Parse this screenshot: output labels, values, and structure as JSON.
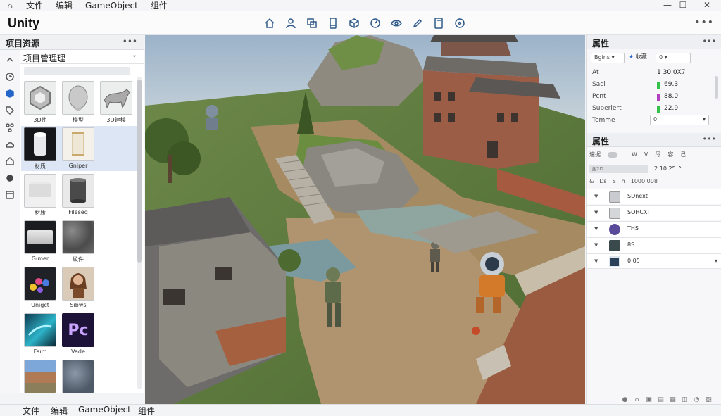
{
  "menubar": {
    "items": [
      "文件",
      "编辑",
      "GameObject",
      "组件"
    ]
  },
  "toolbar": {
    "logo": "Unity",
    "tools": [
      "home-icon",
      "person-icon",
      "layers-icon",
      "device-icon",
      "box-icon",
      "speed-icon",
      "eye-icon",
      "pencil-icon",
      "calculator-icon",
      "target-icon"
    ]
  },
  "left_panel": {
    "title": "项目资源",
    "select_label": "项目管理理",
    "assets": [
      {
        "name": "3D件"
      },
      {
        "name": "模型"
      },
      {
        "name": "3D建模"
      },
      {
        "name": "材质"
      },
      {
        "name": "Gniper"
      },
      {
        "name": "材质"
      },
      {
        "name": "Fileseq"
      },
      {
        "name": "Gımer"
      },
      {
        "name": "纹件"
      },
      {
        "name": "Unigct"
      },
      {
        "name": "Sibws"
      },
      {
        "name": "Faım"
      },
      {
        "name": "Vade"
      },
      {
        "name": ""
      },
      {
        "name": ""
      }
    ],
    "pc_label": "Pc"
  },
  "inspector": {
    "title": "属性",
    "selector": "Bgins",
    "favorite": "收藏",
    "value_select": "0",
    "props": [
      {
        "key": "At",
        "value": "1  30.0X7",
        "color": ""
      },
      {
        "key": "Saci",
        "value": "69.3",
        "color": "#33c24a"
      },
      {
        "key": "Pcnt",
        "value": "88.0",
        "color": "#b040c0"
      },
      {
        "key": "Superiert",
        "value": "22.9",
        "color": "#33c24a"
      },
      {
        "key": "Temme",
        "value": "0",
        "color": ""
      }
    ]
  },
  "layers": {
    "title": "属性",
    "toolbar": [
      "速据",
      "W",
      "V",
      "尽",
      "容",
      "己"
    ],
    "row1_label": "含2D",
    "row1_value": "2:10  25",
    "row2_items": [
      "&",
      "Ds",
      "S",
      "h"
    ],
    "row2_value": "1000  008",
    "items": [
      {
        "label": "SDnext",
        "color": "#c9cbd0"
      },
      {
        "label": "SOHCXI",
        "color": "#d5d6da"
      },
      {
        "label": "THS",
        "color": "#5a4a9a"
      },
      {
        "label": "8S",
        "color": "#3a4a4c"
      },
      {
        "label": "0.05",
        "color": "#2a3f58"
      }
    ],
    "bottom_icons": [
      "●",
      "⌂",
      "▣",
      "▤",
      "▦",
      "◫",
      "◔",
      "▧"
    ]
  },
  "bottombar": {
    "items": [
      "文件",
      "编辑",
      "GameObject",
      "组件"
    ]
  }
}
